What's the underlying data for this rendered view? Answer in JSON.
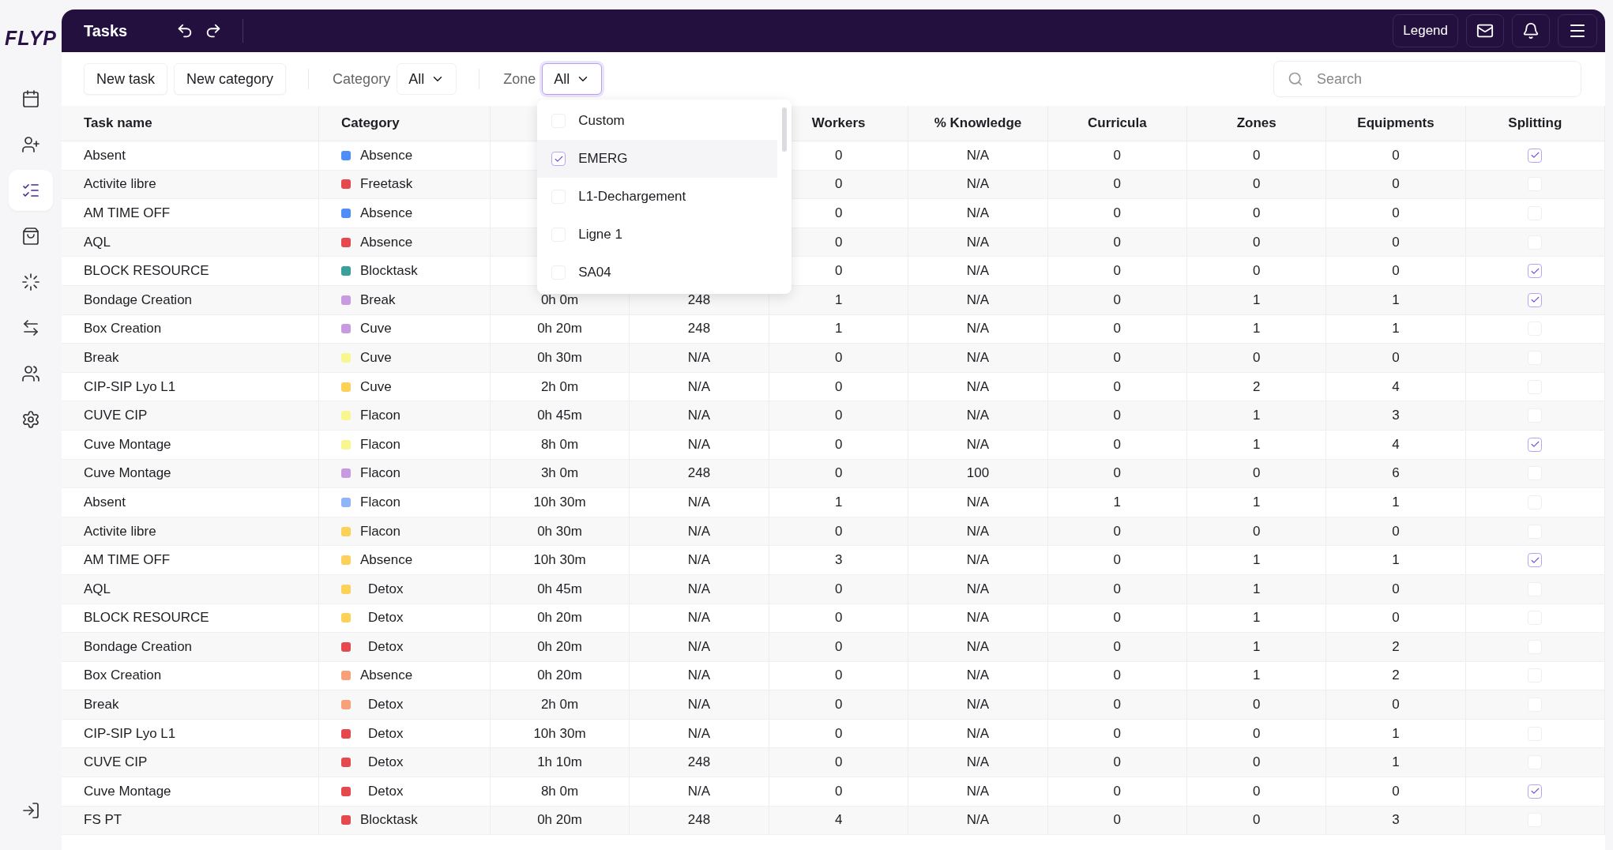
{
  "logo": "FLYP",
  "sidebar": {
    "items": [
      {
        "selected": false
      },
      {
        "selected": false
      },
      {
        "selected": true
      },
      {
        "selected": false
      },
      {
        "selected": false
      },
      {
        "selected": false
      },
      {
        "selected": false
      },
      {
        "selected": false
      }
    ]
  },
  "header": {
    "title": "Tasks",
    "legend": "Legend"
  },
  "toolbar": {
    "buttons": [
      "New task",
      "New category"
    ],
    "category_label": "Category",
    "category_value": "All",
    "zone_label": "Zone",
    "zone_value": "All",
    "zone_open": true,
    "search": {
      "placeholder": "Search"
    }
  },
  "zone_dropdown": [
    {
      "label": "Custom",
      "checked": false
    },
    {
      "label": "EMERG",
      "checked": true
    },
    {
      "label": "L1-Dechargement",
      "checked": false
    },
    {
      "label": "Ligne 1",
      "checked": false
    },
    {
      "label": "SA04",
      "checked": false
    }
  ],
  "table": {
    "columns": {
      "task_name": "Task name",
      "category": "Category",
      "workers": "Workers",
      "knowledge": "% Knowledge",
      "curricula": "Curricula",
      "zones": "Zones",
      "equipments": "Equipments",
      "splitting": "Splitting"
    },
    "rows": [
      {
        "task_name": "Absent",
        "category": {
          "label": "Absence",
          "color": "#4f8ef7",
          "indented": false
        },
        "workers": "0",
        "knowledge": "N/A",
        "curricula": "0",
        "zones": "0",
        "equipments": "0",
        "splitting": true
      },
      {
        "task_name": "Activite libre",
        "category": {
          "label": "Freetask",
          "color": "#e5484d",
          "indented": false
        },
        "workers": "0",
        "knowledge": "N/A",
        "curricula": "0",
        "zones": "0",
        "equipments": "0",
        "splitting": false
      },
      {
        "task_name": "AM TIME OFF",
        "category": {
          "label": "Absence",
          "color": "#4f8ef7",
          "indented": false
        },
        "workers": "0",
        "knowledge": "N/A",
        "curricula": "0",
        "zones": "0",
        "equipments": "0",
        "splitting": false
      },
      {
        "task_name": "AQL",
        "category": {
          "label": "Absence",
          "color": "#e5484d",
          "indented": false
        },
        "workers": "0",
        "knowledge": "N/A",
        "curricula": "0",
        "zones": "0",
        "equipments": "0",
        "splitting": false
      },
      {
        "task_name": "BLOCK RESOURCE",
        "category": {
          "label": "Blocktask",
          "color": "#3aa19a",
          "indented": false
        },
        "workers": "0",
        "knowledge": "N/A",
        "curricula": "0",
        "zones": "0",
        "equipments": "0",
        "splitting": true
      },
      {
        "task_name": "Bondage Creation",
        "category": {
          "label": "Break",
          "color": "#c89be0",
          "indented": false
        },
        "column_3": "0h 0m",
        "column_4": "248",
        "workers": "1",
        "knowledge": "N/A",
        "curricula": "0",
        "zones": "1",
        "equipments": "1",
        "splitting": true
      },
      {
        "task_name": "Box Creation",
        "category": {
          "label": "Cuve",
          "color": "#c89be0",
          "indented": false
        },
        "column_3": "0h 20m",
        "column_4": "248",
        "workers": "1",
        "knowledge": "N/A",
        "curricula": "0",
        "zones": "1",
        "equipments": "1",
        "splitting": false
      },
      {
        "task_name": "Break",
        "category": {
          "label": "Cuve",
          "color": "#f7f68f",
          "indented": false
        },
        "column_3": "0h 30m",
        "column_4": "N/A",
        "workers": "0",
        "knowledge": "N/A",
        "curricula": "0",
        "zones": "0",
        "equipments": "0",
        "splitting": false
      },
      {
        "task_name": "CIP-SIP Lyo L1",
        "category": {
          "label": "Cuve",
          "color": "#fcd15a",
          "indented": false
        },
        "column_3": "2h 0m",
        "column_4": "N/A",
        "workers": "0",
        "knowledge": "N/A",
        "curricula": "0",
        "zones": "2",
        "equipments": "4",
        "splitting": false
      },
      {
        "task_name": "CUVE CIP",
        "category": {
          "label": "Flacon",
          "color": "#f7f68f",
          "indented": false
        },
        "column_3": "0h 45m",
        "column_4": "N/A",
        "workers": "0",
        "knowledge": "N/A",
        "curricula": "0",
        "zones": "1",
        "equipments": "3",
        "splitting": false
      },
      {
        "task_name": "Cuve Montage",
        "category": {
          "label": "Flacon",
          "color": "#f7f68f",
          "indented": false
        },
        "column_3": "8h 0m",
        "column_4": "N/A",
        "workers": "0",
        "knowledge": "N/A",
        "curricula": "0",
        "zones": "1",
        "equipments": "4",
        "splitting": true
      },
      {
        "task_name": "Cuve Montage",
        "category": {
          "label": "Flacon",
          "color": "#c89be0",
          "indented": false
        },
        "column_3": "3h 0m",
        "column_4": "248",
        "workers": "0",
        "knowledge": "100",
        "curricula": "0",
        "zones": "0",
        "equipments": "6",
        "splitting": false
      },
      {
        "task_name": "Absent",
        "category": {
          "label": "Flacon",
          "color": "#8fb4f7",
          "indented": false
        },
        "column_3": "10h 30m",
        "column_4": "N/A",
        "workers": "1",
        "knowledge": "N/A",
        "curricula": "1",
        "zones": "1",
        "equipments": "1",
        "splitting": false
      },
      {
        "task_name": "Activite libre",
        "category": {
          "label": "Flacon",
          "color": "#fcd15a",
          "indented": false
        },
        "column_3": "0h 30m",
        "column_4": "N/A",
        "workers": "0",
        "knowledge": "N/A",
        "curricula": "0",
        "zones": "0",
        "equipments": "0",
        "splitting": false
      },
      {
        "task_name": "AM TIME OFF",
        "category": {
          "label": "Absence",
          "color": "#fcd15a",
          "indented": false
        },
        "column_3": "10h 30m",
        "column_4": "N/A",
        "workers": "3",
        "knowledge": "N/A",
        "curricula": "0",
        "zones": "1",
        "equipments": "1",
        "splitting": true
      },
      {
        "task_name": "AQL",
        "category": {
          "label": "Detox",
          "color": "#fcd15a",
          "indented": true
        },
        "column_3": "0h 45m",
        "column_4": "N/A",
        "workers": "0",
        "knowledge": "N/A",
        "curricula": "0",
        "zones": "1",
        "equipments": "0",
        "splitting": false
      },
      {
        "task_name": "BLOCK RESOURCE",
        "category": {
          "label": "Detox",
          "color": "#fcd15a",
          "indented": true
        },
        "column_3": "0h 20m",
        "column_4": "N/A",
        "workers": "0",
        "knowledge": "N/A",
        "curricula": "0",
        "zones": "1",
        "equipments": "0",
        "splitting": false
      },
      {
        "task_name": "Bondage Creation",
        "category": {
          "label": "Detox",
          "color": "#e5484d",
          "indented": true
        },
        "column_3": "0h 20m",
        "column_4": "N/A",
        "workers": "0",
        "knowledge": "N/A",
        "curricula": "0",
        "zones": "1",
        "equipments": "2",
        "splitting": false
      },
      {
        "task_name": "Box Creation",
        "category": {
          "label": "Absence",
          "color": "#f7a07a",
          "indented": false
        },
        "column_3": "0h 20m",
        "column_4": "N/A",
        "workers": "0",
        "knowledge": "N/A",
        "curricula": "0",
        "zones": "1",
        "equipments": "2",
        "splitting": false
      },
      {
        "task_name": "Break",
        "category": {
          "label": "Detox",
          "color": "#f7a07a",
          "indented": true
        },
        "column_3": "2h 0m",
        "column_4": "N/A",
        "workers": "0",
        "knowledge": "N/A",
        "curricula": "0",
        "zones": "0",
        "equipments": "0",
        "splitting": false
      },
      {
        "task_name": "CIP-SIP Lyo L1",
        "category": {
          "label": "Detox",
          "color": "#e5484d",
          "indented": true
        },
        "column_3": "10h 30m",
        "column_4": "N/A",
        "workers": "0",
        "knowledge": "N/A",
        "curricula": "0",
        "zones": "0",
        "equipments": "1",
        "splitting": false
      },
      {
        "task_name": "CUVE CIP",
        "category": {
          "label": "Detox",
          "color": "#e5484d",
          "indented": true
        },
        "column_3": "1h 10m",
        "column_4": "248",
        "workers": "0",
        "knowledge": "N/A",
        "curricula": "0",
        "zones": "0",
        "equipments": "1",
        "splitting": false
      },
      {
        "task_name": "Cuve Montage",
        "category": {
          "label": "Detox",
          "color": "#e5484d",
          "indented": true
        },
        "column_3": "8h 0m",
        "column_4": "N/A",
        "workers": "0",
        "knowledge": "N/A",
        "curricula": "0",
        "zones": "0",
        "equipments": "0",
        "splitting": true
      },
      {
        "task_name": "FS PT",
        "category": {
          "label": "Blocktask",
          "color": "#e5484d",
          "indented": false
        },
        "column_3": "0h 20m",
        "column_4": "248",
        "workers": "4",
        "knowledge": "N/A",
        "curricula": "0",
        "zones": "0",
        "equipments": "3",
        "splitting": false
      }
    ]
  }
}
